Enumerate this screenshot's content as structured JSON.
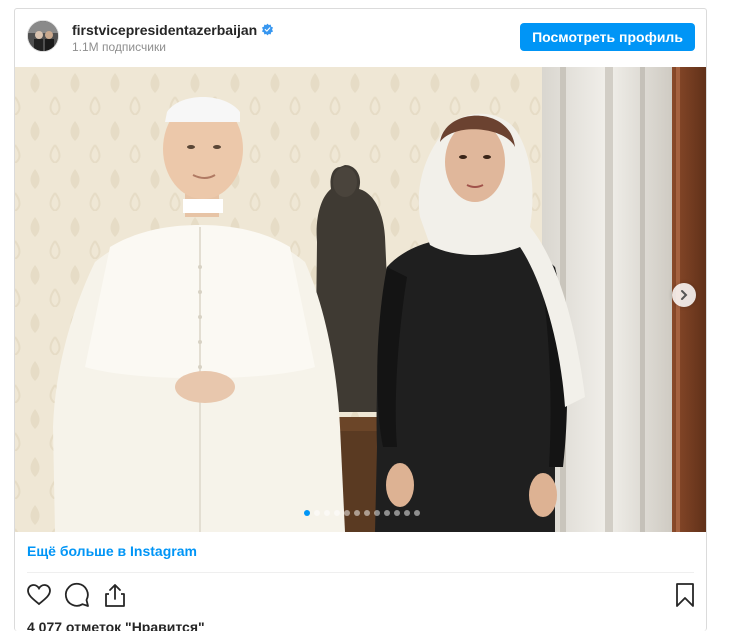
{
  "post": {
    "username": "firstvicepresidentazerbaijan",
    "followers": "1.1M подписчики",
    "view_profile_label": "Посмотреть профиль",
    "verified_icon": "verified-badge-icon",
    "more_link": "Ещё больше в Instagram",
    "likes": "4 077 отметок \"Нравится\""
  },
  "carousel": {
    "dots_total": 12,
    "active_index": 0
  },
  "icons": {
    "like": "heart-icon",
    "comment": "comment-icon",
    "share": "share-icon",
    "save": "bookmark-icon",
    "next": "chevron-right-icon"
  },
  "colors": {
    "accent": "#0095f6",
    "text": "#262626",
    "secondary": "#8e8e8e",
    "border": "#dbdbdb"
  }
}
